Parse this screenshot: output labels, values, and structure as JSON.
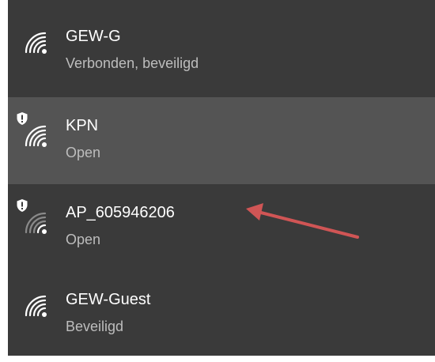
{
  "networks": [
    {
      "name": "GEW-G",
      "status": "Verbonden, beveiligd",
      "icon": "wifi-icon",
      "secured": true,
      "warning": false,
      "selected": false
    },
    {
      "name": "KPN",
      "status": "Open",
      "icon": "wifi-icon",
      "secured": false,
      "warning": true,
      "selected": true
    },
    {
      "name": "AP_605946206",
      "status": "Open",
      "icon": "wifi-icon",
      "secured": false,
      "warning": true,
      "selected": false
    },
    {
      "name": "GEW-Guest",
      "status": "Beveiligd",
      "icon": "wifi-icon",
      "secured": true,
      "warning": false,
      "selected": false
    }
  ],
  "annotation": {
    "type": "arrow",
    "color": "#d05555",
    "points_to": "AP_605946206"
  },
  "colors": {
    "panel_bg": "#3a3a3a",
    "selected_bg": "#545454",
    "text_primary": "#ffffff",
    "text_secondary": "#bdbdbd"
  }
}
